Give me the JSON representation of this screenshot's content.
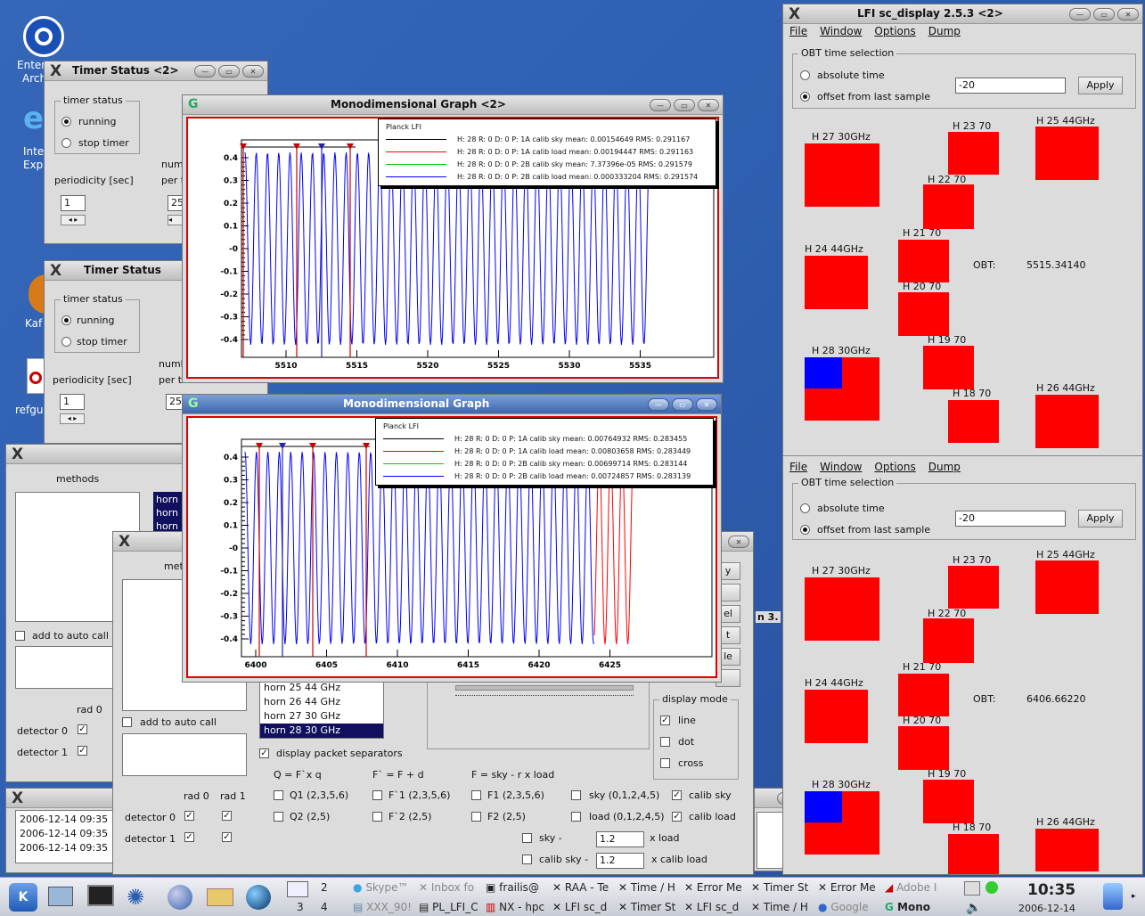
{
  "desktop": {
    "icons": [
      "Enter",
      "Arch",
      "Inte",
      "Exp",
      "Kaf",
      "refgu"
    ]
  },
  "timer1": {
    "title": "Timer Status <2>",
    "group": "timer status",
    "running": "running",
    "stop": "stop timer",
    "periodicity": "periodicity [sec]",
    "period_value": "1",
    "num": "num",
    "per": "per t",
    "num_value": "25"
  },
  "timer2": {
    "title": "Timer Status",
    "group": "timer status",
    "running": "running",
    "stop": "stop timer",
    "periodicity": "periodicity [sec]",
    "period_value": "1",
    "num": "numb",
    "per": "per t",
    "num_value": "25"
  },
  "methods_back": {
    "methods": "methods",
    "horn_items": [
      "horn",
      "horn",
      "horn"
    ],
    "add_auto": "add to auto call",
    "rad0": "rad 0",
    "detector0": "detector 0",
    "detector1": "detector 1"
  },
  "log": {
    "lines": [
      "2006-12-14 09:35",
      "2006-12-14 09:35",
      "2006-12-14 09:35"
    ]
  },
  "methods_front": {
    "methods": "met",
    "horn_items": [
      "horn 25  44 GHz",
      "horn 26  44 GHz",
      "horn 27  30 GHz",
      "horn 28  30 GHz"
    ],
    "add_auto": "add to auto call",
    "separators": "display packet separators",
    "q_formula": "Q = F`x q",
    "f_formula": "F` = F + d",
    "fsky_formula": "F = sky - r x load",
    "rad0": "rad 0",
    "rad1": "rad 1",
    "detector0": "detector 0",
    "detector1": "detector 1",
    "q1": "Q1 (2,3,5,6)",
    "q2": "Q2 (2,5)",
    "fp1": "F`1 (2,3,5,6)",
    "fp2": "F`2 (2,5)",
    "f1": "F1 (2,3,5,6)",
    "f2": "F2 (2,5)",
    "sky": "sky (0,1,2,4,5)",
    "load": "load (0,1,2,4,5)",
    "calib_sky": "calib sky",
    "calib_load": "calib load",
    "sky_minus": "sky -",
    "sky_minus_val": "1.2",
    "x_load": "x load",
    "calib_sky_minus": "calib sky -",
    "calib_sky_minus_val": "1.2",
    "x_calib_load": "x calib load",
    "display_mode": "display mode",
    "line": "line",
    "dot": "dot",
    "cross": "cross",
    "side_buttons": [
      "y",
      "",
      "el",
      "t",
      "le",
      ""
    ],
    "partial_title": "n 3."
  },
  "graph2": {
    "title": "Monodimensional Graph <2>",
    "legend_title": "Planck LFI",
    "legend": [
      {
        "text": "H: 28 R: 0 D: 0 P: 1A calib sky mean: 0.00154649 RMS: 0.291167",
        "color": "#000000"
      },
      {
        "text": "H: 28 R: 0 D: 0 P: 1A calib load mean: 0.00194447 RMS: 0.291163",
        "color": "#ff0000"
      },
      {
        "text": "H: 28 R: 0 D: 0 P: 2B calib sky mean: 7.37396e-05 RMS: 0.291579",
        "color": "#00cc00"
      },
      {
        "text": "H: 28 R: 0 D: 0 P: 2B calib load mean: 0.000333204 RMS: 0.291574",
        "color": "#0000ff"
      }
    ],
    "yticks": [
      "0.4",
      "0.3",
      "0.2",
      "0.1",
      "-0",
      "-0.1",
      "-0.2",
      "-0.3",
      "-0.4"
    ],
    "xticks": [
      "5510",
      "5515",
      "5520",
      "5525",
      "5530",
      "5535"
    ]
  },
  "graph1": {
    "title": "Monodimensional Graph",
    "legend_title": "Planck LFI",
    "legend": [
      {
        "text": "H: 28 R: 0 D: 0 P: 1A calib sky mean: 0.00764932 RMS: 0.283455",
        "color": "#000000"
      },
      {
        "text": "H: 28 R: 0 D: 0 P: 1A calib load mean: 0.00803658 RMS: 0.283449",
        "color": "#ff0000"
      },
      {
        "text": "H: 28 R: 0 D: 0 P: 2B calib sky mean: 0.00699714 RMS: 0.283144",
        "color": "#00cc00"
      },
      {
        "text": "H: 28 R: 0 D: 0 P: 2B calib load mean: 0.00724857 RMS: 0.283139",
        "color": "#0000ff"
      }
    ],
    "yticks": [
      "0.4",
      "0.3",
      "0.2",
      "0.1",
      "-0",
      "-0.1",
      "-0.2",
      "-0.3",
      "-0.4"
    ],
    "xticks": [
      "6400",
      "6405",
      "6410",
      "6415",
      "6420",
      "6425"
    ]
  },
  "display1": {
    "title": "LFI sc_display  2.5.3 <2>",
    "menu": [
      "File",
      "Window",
      "Options",
      "Dump"
    ],
    "obt_group": "OBT time selection",
    "absolute": "absolute time",
    "offset": "offset from last sample",
    "offset_value": "-20",
    "apply": "Apply",
    "obt_label": "OBT:",
    "obt_value": "5515.34140",
    "horns": [
      "H 27 30GHz",
      "H 23 70",
      "H 25 44GHz",
      "H 22 70",
      "H 21 70",
      "H 24 44GHz",
      "H 20 70",
      "H 19 70",
      "H 28 30GHz",
      "H 18 70",
      "H 26 44GHz"
    ]
  },
  "display2": {
    "menu": [
      "File",
      "Window",
      "Options",
      "Dump"
    ],
    "obt_group": "OBT time selection",
    "absolute": "absolute time",
    "offset": "offset from last sample",
    "offset_value": "-20",
    "apply": "Apply",
    "obt_label": "OBT:",
    "obt_value": "6406.66220",
    "horns": [
      "H 27 30GHz",
      "H 23 70",
      "H 25 44GHz",
      "H 22 70",
      "H 21 70",
      "H 24 44GHz",
      "H 20 70",
      "H 19 70",
      "H 28 30GHz",
      "H 18 70",
      "H 26 44GHz"
    ]
  },
  "taskbar": {
    "pager": [
      "2",
      "3",
      "4"
    ],
    "tasks_top": [
      "Skype™",
      "Inbox fo",
      "frailis@",
      "RAA - Te",
      "Time / H",
      "Error Me",
      "Timer St",
      "Error Me",
      "Adobe I"
    ],
    "tasks_bottom": [
      "XXX_90!",
      "PL_LFI_C",
      "NX - hpc",
      "LFI sc_d",
      "Timer St",
      "LFI sc_d",
      "Time / H",
      "Google",
      "Mono"
    ],
    "clock_time": "10:35",
    "clock_date": "2006-12-14"
  }
}
